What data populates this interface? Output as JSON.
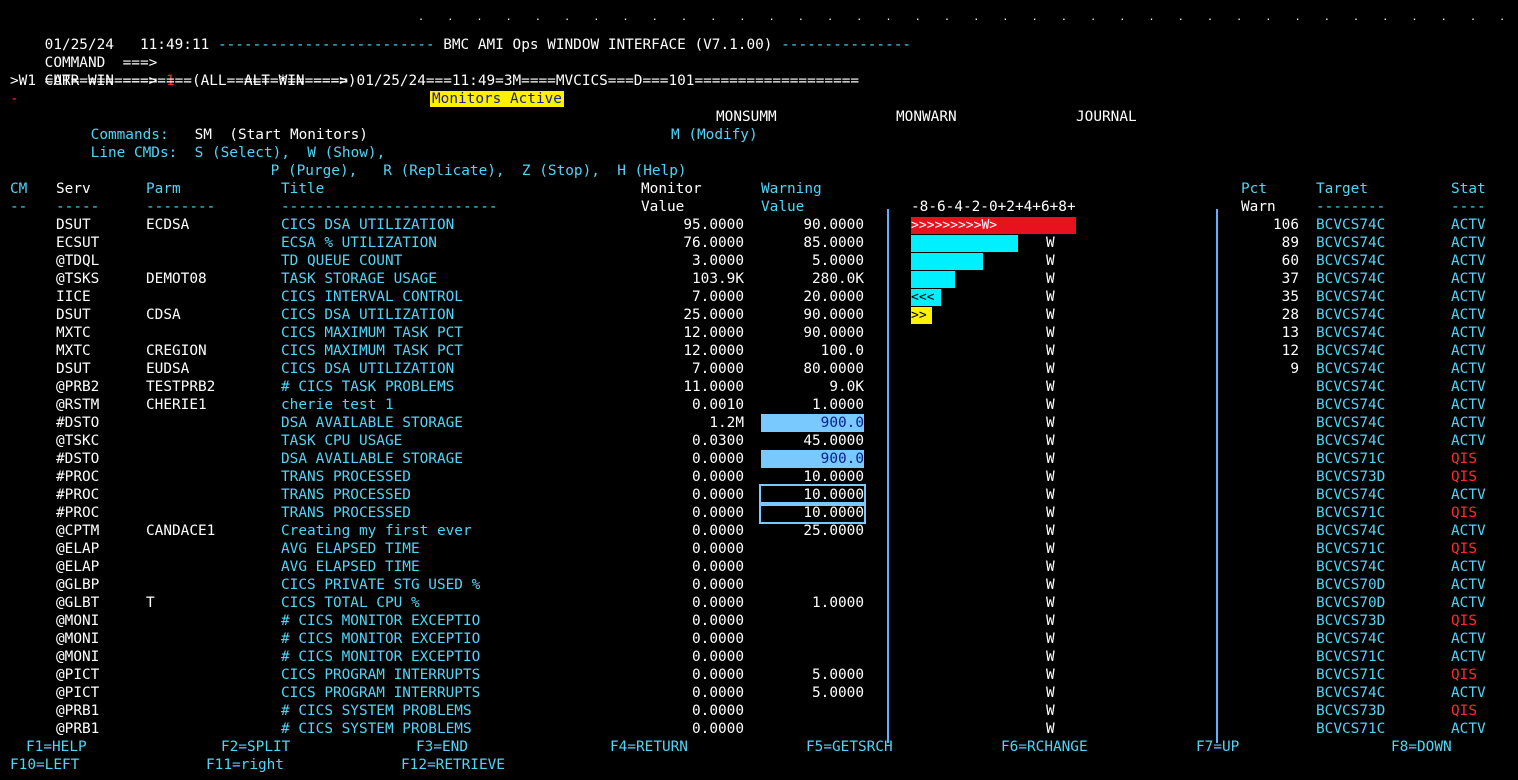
{
  "header": {
    "date": "01/25/24",
    "time": "11:49:11",
    "title": "BMC AMI Ops WINDOW INTERFACE (V7.1.00)",
    "command_label": "COMMAND  ===>",
    "command_value": "",
    "curr_win_label": "CURR WIN ===>",
    "curr_win_value": "1",
    "alt_win_label": "ALT WIN ===>",
    "alt_win_value": "",
    "window_line": ">W1 =AT==============(ALL======*=======)01/25/24===11:49=3M====MVCICS===D===101===================",
    "cursor": "-",
    "status_banner": "Monitors Active"
  },
  "commands": {
    "label": "Commands:",
    "sm": "SM  (Start Monitors)",
    "monsumm": "MONSUMM",
    "monwarn": "MONWARN",
    "journal": "JOURNAL",
    "line_label": "Line CMDs:",
    "select": "S (Select),",
    "show": "W (Show),",
    "modify": "M (Modify)",
    "purge": "P (Purge),",
    "replicate": "R (Replicate),",
    "stop": "Z (Stop),",
    "help": "H (Help)"
  },
  "columns": {
    "cm": "CM",
    "serv": "Serv",
    "parm": "Parm",
    "title": "Title",
    "monitor": "Monitor",
    "value": "Value",
    "warning": "Warning",
    "wvalue": "Value",
    "scale": "-8-6-4-2-0+2+4+6+8+",
    "pct": "Pct",
    "warn": "Warn",
    "target": "Target",
    "stat": "Stat",
    "u_cm": "--",
    "u_serv": "-----",
    "u_parm": "--------",
    "u_title": "-------------------------",
    "u_pct": "-----",
    "u_target": "--------",
    "u_stat": "----"
  },
  "rows": [
    {
      "serv": "DSUT",
      "parm": "ECDSA",
      "title": "CICS DSA UTILIZATION",
      "mv": "95.0000",
      "wv": "90.0000",
      "pct": "106",
      "target": "BCVCS74C",
      "stat": "ACTV",
      "bar": ">>>>>>>>>W>",
      "bar_fill": 1.0,
      "bar_color": "#e8121e"
    },
    {
      "serv": "ECSUT",
      "parm": "",
      "title": "ECSA % UTILIZATION",
      "mv": "76.0000",
      "wv": "85.0000",
      "pct": "89",
      "target": "BCVCS74C",
      "stat": "ACTV",
      "bar_fill": 0.89,
      "bar_color": "#00f0ff"
    },
    {
      "serv": "@TDQL",
      "parm": "",
      "title": "TD QUEUE COUNT",
      "mv": "3.0000",
      "wv": "5.0000",
      "pct": "60",
      "target": "BCVCS74C",
      "stat": "ACTV",
      "bar_fill": 0.6,
      "bar_color": "#00f0ff"
    },
    {
      "serv": "@TSKS",
      "parm": "DEMOT08",
      "title": "TASK STORAGE USAGE",
      "mv": "103.9K",
      "wv": "280.0K",
      "pct": "37",
      "target": "BCVCS74C",
      "stat": "ACTV",
      "bar_fill": 0.37,
      "bar_color": "#00f0ff"
    },
    {
      "serv": "IICE",
      "parm": "",
      "title": "CICS INTERVAL CONTROL",
      "mv": "7.0000",
      "wv": "20.0000",
      "pct": "35",
      "target": "BCVCS74C",
      "stat": "ACTV",
      "bar": "<<<",
      "bar_fill": 0.35,
      "bar_color": "#00f0ff"
    },
    {
      "serv": "DSUT",
      "parm": "CDSA",
      "title": "CICS DSA UTILIZATION",
      "mv": "25.0000",
      "wv": "90.0000",
      "pct": "28",
      "target": "BCVCS74C",
      "stat": "ACTV",
      "bar": ">>",
      "bar_fill": 0.28,
      "bar_color": "#fff200"
    },
    {
      "serv": "MXTC",
      "parm": "",
      "title": "CICS MAXIMUM TASK PCT",
      "mv": "12.0000",
      "wv": "90.0000",
      "pct": "13",
      "target": "BCVCS74C",
      "stat": "ACTV"
    },
    {
      "serv": "MXTC",
      "parm": "CREGION",
      "title": "CICS MAXIMUM TASK PCT",
      "mv": "12.0000",
      "wv": "100.0",
      "pct": "12",
      "target": "BCVCS74C",
      "stat": "ACTV"
    },
    {
      "serv": "DSUT",
      "parm": "EUDSA",
      "title": "CICS DSA UTILIZATION",
      "mv": "7.0000",
      "wv": "80.0000",
      "pct": "9",
      "target": "BCVCS74C",
      "stat": "ACTV"
    },
    {
      "serv": "@PRB2",
      "parm": "TESTPRB2",
      "title": "# CICS TASK PROBLEMS",
      "mv": "11.0000",
      "wv": "9.0K",
      "pct": "",
      "target": "BCVCS74C",
      "stat": "ACTV"
    },
    {
      "serv": "@RSTM",
      "parm": "CHERIE1",
      "title": "cherie test 1",
      "mv": "0.0010",
      "wv": "1.0000",
      "pct": "",
      "target": "BCVCS74C",
      "stat": "ACTV"
    },
    {
      "serv": "#DSTO",
      "parm": "",
      "title": "DSA AVAILABLE STORAGE",
      "mv": "1.2M",
      "wv": "900.0",
      "wv_style": "box",
      "pct": "",
      "target": "BCVCS74C",
      "stat": "ACTV"
    },
    {
      "serv": "@TSKC",
      "parm": "",
      "title": "TASK CPU USAGE",
      "mv": "0.0300",
      "wv": "45.0000",
      "pct": "",
      "target": "BCVCS74C",
      "stat": "ACTV"
    },
    {
      "serv": "#DSTO",
      "parm": "",
      "title": "DSA AVAILABLE STORAGE",
      "mv": "0.0000",
      "wv": "900.0",
      "wv_style": "box",
      "pct": "",
      "target": "BCVCS71C",
      "stat": "QIS"
    },
    {
      "serv": "#PROC",
      "parm": "",
      "title": "TRANS PROCESSED",
      "mv": "0.0000",
      "wv": "10.0000",
      "pct": "",
      "target": "BCVCS73D",
      "stat": "QIS"
    },
    {
      "serv": "#PROC",
      "parm": "",
      "title": "TRANS PROCESSED",
      "mv": "0.0000",
      "wv": "10.0000",
      "wv_style": "boxo",
      "pct": "",
      "target": "BCVCS74C",
      "stat": "ACTV"
    },
    {
      "serv": "#PROC",
      "parm": "",
      "title": "TRANS PROCESSED",
      "mv": "0.0000",
      "wv": "10.0000",
      "wv_style": "boxo",
      "pct": "",
      "target": "BCVCS71C",
      "stat": "QIS"
    },
    {
      "serv": "@CPTM",
      "parm": "CANDACE1",
      "title": "Creating my first ever",
      "mv": "0.0000",
      "wv": "25.0000",
      "pct": "",
      "target": "BCVCS74C",
      "stat": "ACTV"
    },
    {
      "serv": "@ELAP",
      "parm": "",
      "title": "AVG ELAPSED TIME",
      "mv": "0.0000",
      "wv": "",
      "pct": "",
      "target": "BCVCS71C",
      "stat": "QIS"
    },
    {
      "serv": "@ELAP",
      "parm": "",
      "title": "AVG ELAPSED TIME",
      "mv": "0.0000",
      "wv": "",
      "pct": "",
      "target": "BCVCS74C",
      "stat": "ACTV"
    },
    {
      "serv": "@GLBP",
      "parm": "",
      "title": "CICS PRIVATE STG USED %",
      "mv": "0.0000",
      "wv": "",
      "pct": "",
      "target": "BCVCS70D",
      "stat": "ACTV"
    },
    {
      "serv": "@GLBT",
      "parm": "T",
      "title": "CICS TOTAL CPU %",
      "mv": "0.0000",
      "wv": "1.0000",
      "pct": "",
      "target": "BCVCS70D",
      "stat": "ACTV"
    },
    {
      "serv": "@MONI",
      "parm": "",
      "title": "# CICS MONITOR EXCEPTIO",
      "mv": "0.0000",
      "wv": "",
      "pct": "",
      "target": "BCVCS73D",
      "stat": "QIS"
    },
    {
      "serv": "@MONI",
      "parm": "",
      "title": "# CICS MONITOR EXCEPTIO",
      "mv": "0.0000",
      "wv": "",
      "pct": "",
      "target": "BCVCS74C",
      "stat": "ACTV"
    },
    {
      "serv": "@MONI",
      "parm": "",
      "title": "# CICS MONITOR EXCEPTIO",
      "mv": "0.0000",
      "wv": "",
      "pct": "",
      "target": "BCVCS71C",
      "stat": "ACTV"
    },
    {
      "serv": "@PICT",
      "parm": "",
      "title": "CICS PROGRAM INTERRUPTS",
      "mv": "0.0000",
      "wv": "5.0000",
      "pct": "",
      "target": "BCVCS71C",
      "stat": "QIS"
    },
    {
      "serv": "@PICT",
      "parm": "",
      "title": "CICS PROGRAM INTERRUPTS",
      "mv": "0.0000",
      "wv": "5.0000",
      "pct": "",
      "target": "BCVCS74C",
      "stat": "ACTV"
    },
    {
      "serv": "@PRB1",
      "parm": "",
      "title": "# CICS SYSTEM PROBLEMS",
      "mv": "0.0000",
      "wv": "",
      "pct": "",
      "target": "BCVCS73D",
      "stat": "QIS"
    },
    {
      "serv": "@PRB1",
      "parm": "",
      "title": "# CICS SYSTEM PROBLEMS",
      "mv": "0.0000",
      "wv": "",
      "pct": "",
      "target": "BCVCS71C",
      "stat": "ACTV"
    }
  ],
  "warn_marker": "W",
  "fkeys": [
    {
      "label": "F1=HELP"
    },
    {
      "label": "F2=SPLIT"
    },
    {
      "label": "F3=END"
    },
    {
      "label": "F4=RETURN"
    },
    {
      "label": "F5=GETSRCH"
    },
    {
      "label": "F6=RCHANGE"
    },
    {
      "label": "F7=UP"
    },
    {
      "label": "F8=DOWN"
    },
    {
      "label": "F10=LEFT"
    },
    {
      "label": "F11=right"
    },
    {
      "label": "F12=RETRIEVE"
    }
  ],
  "colors": {
    "qis": "#ff2a2a",
    "actv": "#4fd6f7"
  }
}
